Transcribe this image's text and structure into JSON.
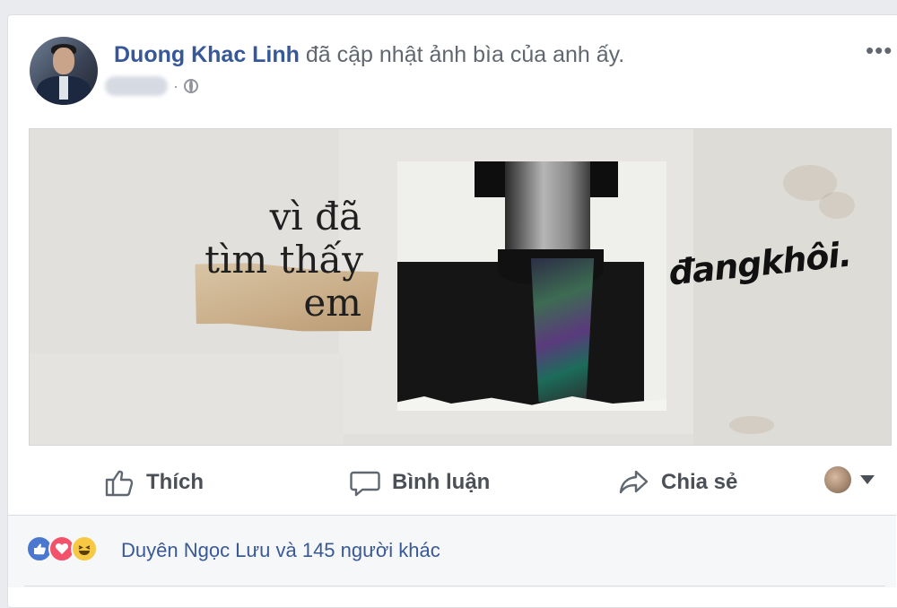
{
  "post": {
    "author": "Duong Khac Linh",
    "action_text": "đã cập nhật ảnh bìa của anh ấy."
  },
  "cover": {
    "text_line1": "vì đã",
    "text_line2": "tìm thấy",
    "text_line3": "em",
    "signature": "đangkhôi."
  },
  "actions": {
    "like": "Thích",
    "comment": "Bình luận",
    "share": "Chia sẻ"
  },
  "reactions": {
    "summary": "Duyên Ngọc Lưu và 145 người khác",
    "types": [
      "like-icon",
      "love-icon",
      "haha-icon"
    ]
  },
  "colors": {
    "link": "#365899",
    "meta": "#616770",
    "like": "#4a78d1",
    "love": "#f2536b",
    "haha": "#f7c844"
  }
}
